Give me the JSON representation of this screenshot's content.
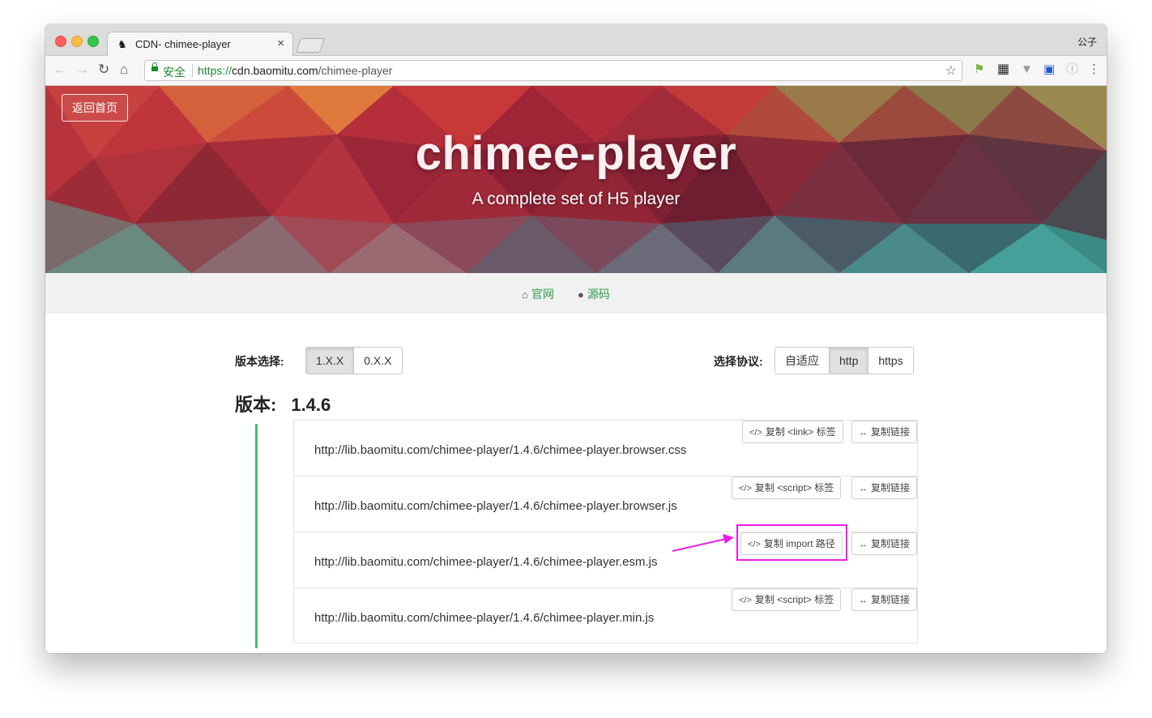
{
  "browser": {
    "tab_title": "CDN- chimee-player",
    "tab_close": "×",
    "profile_name": "公子",
    "secure_label": "安全",
    "url_scheme": "https://",
    "url_host": "cdn.baomitu.com",
    "url_path": "/chimee-player"
  },
  "hero": {
    "back_home": "返回首页",
    "title": "chimee-player",
    "subtitle": "A complete set of H5 player"
  },
  "links": {
    "official": "官网",
    "source": "源码"
  },
  "version_select": {
    "label": "版本选择:",
    "options": [
      "1.X.X",
      "0.X.X"
    ],
    "active": "1.X.X"
  },
  "protocol_select": {
    "label": "选择协议:",
    "options": [
      "自适应",
      "http",
      "https"
    ],
    "active": "http"
  },
  "version": {
    "label": "版本:",
    "number": "1.4.6"
  },
  "files": [
    {
      "url": "http://lib.baomitu.com/chimee-player/1.4.6/chimee-player.browser.css",
      "tag_button": "复制 <link> 标签",
      "link_button": "复制链接"
    },
    {
      "url": "http://lib.baomitu.com/chimee-player/1.4.6/chimee-player.browser.js",
      "tag_button": "复制 <script> 标签",
      "link_button": "复制链接"
    },
    {
      "url": "http://lib.baomitu.com/chimee-player/1.4.6/chimee-player.esm.js",
      "tag_button": "复制 import 路径",
      "link_button": "复制链接"
    },
    {
      "url": "http://lib.baomitu.com/chimee-player/1.4.6/chimee-player.min.js",
      "tag_button": "复制 <script> 标签",
      "link_button": "复制链接"
    }
  ],
  "colors": {
    "accent_green": "#2e9a4a",
    "timeline_green": "#3fbf6f",
    "annotation_magenta": "#e81de8",
    "secure_green": "#1a8b2f"
  }
}
